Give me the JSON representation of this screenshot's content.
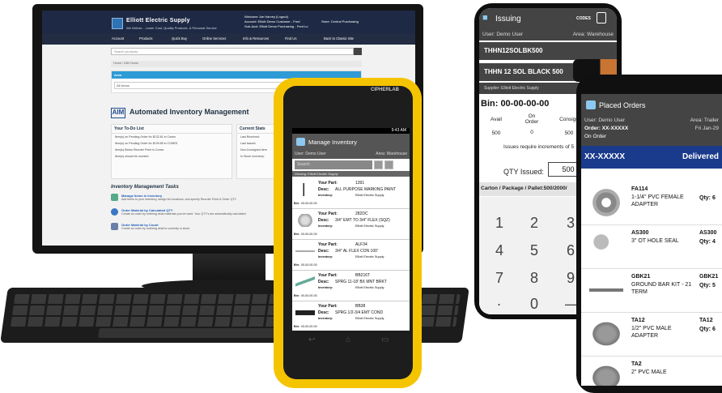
{
  "desktop": {
    "site_name": "Elliott Electric Supply",
    "tagline": "We Deliver... Lower Cost, Quality Products, & Personal Service",
    "welcome": "Welcome Joe Harvey (Logout)",
    "account": "Account: Elliott Demo Customer - Fred",
    "store": "Store: Central Purchasing",
    "subaccount": "Sub-Acct: Elliott Demo Purchasing - Fred Lo",
    "nav": [
      "Account",
      "Products",
      "Quick Buy",
      "Online Services",
      "Info & Resources",
      "Find Us",
      "Back to Classic Site"
    ],
    "search_placeholder": "Search products",
    "breadcrumb": "Home / AIM Home",
    "area_label": "Area",
    "area_value": "All Areas",
    "aim_logo": "AIM",
    "aim_title": "Automated Inventory Management",
    "todo_title": "Your To-Do List",
    "todo_items": [
      "Item(s) on Pending Order for $132.81 in Cones",
      "Item(s) on Pending Order for $199.89 in CONES",
      "Item(s) Below Reorder Point in Cones",
      "Item(s) should be counted"
    ],
    "stats_title": "Current Stats",
    "stats_items": [
      "Last Received:",
      "Last Issued:",
      "Non-Consigned item",
      "In Stock Inventory:"
    ],
    "tasks_title": "Inventory Management Tasks",
    "tasks": [
      {
        "title": "Manage Items in Inventory",
        "desc": "Add items to your inventory, assign bin locations, and specify Reorder Point & Order QTY."
      },
      {
        "title": "Order Material by Calculated QTY",
        "desc": "Create an order by entering what materials you've used. Your QTY's are automatically calculated"
      },
      {
        "title": "Order Material by Count",
        "desc": "Create an order by entering what is currently in stock."
      }
    ]
  },
  "scanner": {
    "brand": "CIPHERLAB",
    "time": "9:43 AM",
    "title": "Manage Inventory",
    "user": "User: Demo User",
    "area": "Area: Warehouse",
    "search": "Search",
    "viewing": "Viewing: Elliott Electric Supply",
    "your_part": "Your Part:",
    "desc": "Desc:",
    "inventory": "Inventory:",
    "bin": "Bin:",
    "items": [
      {
        "part": "1391",
        "desc": "ALL PURPOSE MARKING PAINT",
        "inv": "Elliott Electric Supply",
        "bin": "00-00-00-00"
      },
      {
        "part": "282DC",
        "desc": "3/4\" EMT TO 3/4\" FLEX (SQZ)",
        "inv": "Elliott Electric Supply",
        "bin": "00-00-00-00"
      },
      {
        "part": "ALF34",
        "desc": "3/4\" AL FLEX CON 100'",
        "inv": "Elliott Electric Supply",
        "bin": "00-00-00-00"
      },
      {
        "part": "BB216T",
        "desc": "SPRG 11-18' BX MNT BRKT",
        "inv": "Elliott Electric Supply",
        "bin": "00-00-00-00"
      },
      {
        "part": "BB38",
        "desc": "SPRG 1/2-3/4 EMT COND",
        "inv": "Elliott Electric Supply",
        "bin": "00-00-00-00"
      }
    ]
  },
  "issuing": {
    "title": "Issuing",
    "codes": "CODES",
    "user": "User: Demo User",
    "area": "Area: Warehouse",
    "item_code": "THHN12SOLBK500",
    "item_desc": "THHN 12 SOL BLACK 500",
    "supplier": "Supplier: Elliott Electric Supply",
    "bin": "Bin: 00-00-00-00",
    "cols": [
      {
        "label": "Avail",
        "value": "500"
      },
      {
        "label": "On Order",
        "value": "0"
      },
      {
        "label": "Consign",
        "value": "500"
      }
    ],
    "requirement": "Issues require increments of 5",
    "qty_label": "QTY Issued:",
    "qty_value": "500",
    "package": "Carton / Package / Pallet:500/2000/",
    "keys": [
      "1",
      "2",
      "3",
      "4",
      "5",
      "6",
      "7",
      "8",
      "9",
      ".",
      "0",
      "—"
    ]
  },
  "orders": {
    "title": "Placed Orders",
    "user": "User: Demo User",
    "area": "Area: Trailer",
    "order": "Order: XX-XXXXX",
    "date": "Fri Jan-29",
    "status": "On Order",
    "order_no": "XX-XXXXX",
    "order_status": "Delivered",
    "items": [
      {
        "code": "FA114",
        "desc": "1-1/4\" PVC FEMALE ADAPTER",
        "code2": "",
        "qty": "Qty: 6"
      },
      {
        "code": "AS300",
        "desc": "3\" OT HOLE SEAL",
        "code2": "AS300",
        "qty": "Qty: 4"
      },
      {
        "code": "GBK21",
        "desc": "GROUND BAR KIT - 21 TERM",
        "code2": "GBK21",
        "qty": "Qty: 5"
      },
      {
        "code": "TA12",
        "desc": "1/2\" PVC MALE ADAPTER",
        "code2": "TA12",
        "qty": "Qty: 6"
      },
      {
        "code": "TA2",
        "desc": "2\" PVC MALE",
        "code2": "",
        "qty": ""
      }
    ]
  }
}
